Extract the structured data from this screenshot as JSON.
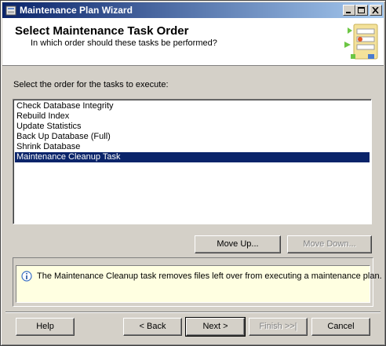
{
  "window": {
    "title": "Maintenance Plan Wizard"
  },
  "header": {
    "title": "Select Maintenance Task Order",
    "subtitle": "In which order should these tasks be performed?"
  },
  "list_label": "Select the order for the tasks to execute:",
  "tasks": [
    {
      "label": "Check Database Integrity",
      "selected": false
    },
    {
      "label": "Rebuild Index",
      "selected": false
    },
    {
      "label": "Update Statistics",
      "selected": false
    },
    {
      "label": "Back Up Database (Full)",
      "selected": false
    },
    {
      "label": "Shrink Database",
      "selected": false
    },
    {
      "label": "Maintenance Cleanup Task",
      "selected": true
    }
  ],
  "buttons": {
    "move_up": "Move Up...",
    "move_down": "Move Down...",
    "help": "Help",
    "back": "< Back",
    "next": "Next >",
    "finish": "Finish >>|",
    "cancel": "Cancel"
  },
  "info": {
    "icon": "info-icon",
    "text": "The Maintenance Cleanup task removes files left over from executing a maintenance plan."
  },
  "colors": {
    "title_bar": "#0a246a",
    "selection": "#0a246a",
    "info_background": "#ffffe1"
  }
}
